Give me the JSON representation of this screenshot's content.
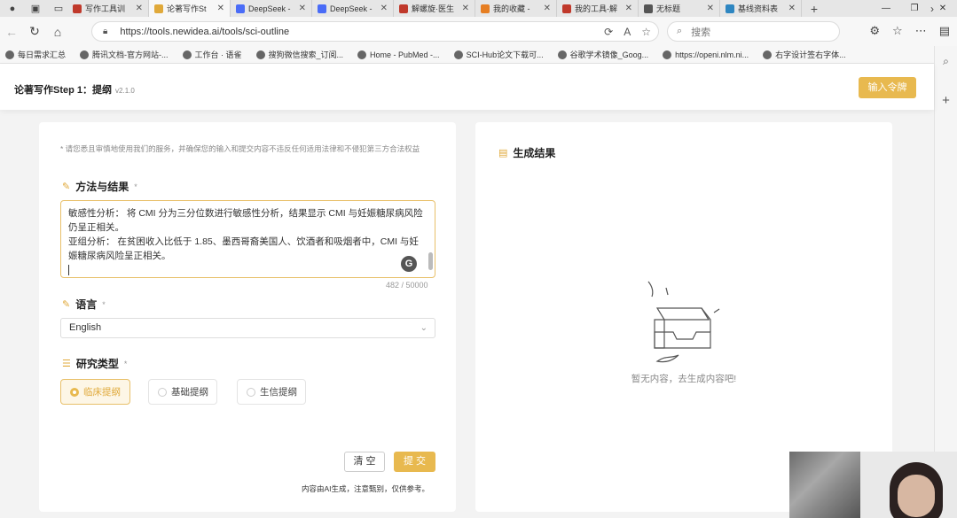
{
  "browser": {
    "tabs": [
      {
        "title": "写作工具训",
        "color": "#c0392b",
        "active": false
      },
      {
        "title": "论著写作St",
        "color": "#e0a93a",
        "active": true
      },
      {
        "title": "DeepSeek -",
        "color": "#4a6cf7",
        "active": false
      },
      {
        "title": "DeepSeek -",
        "color": "#4a6cf7",
        "active": false
      },
      {
        "title": "解螺旋·医生",
        "color": "#c0392b",
        "active": false
      },
      {
        "title": "我的收藏 - ",
        "color": "#e67e22",
        "active": false
      },
      {
        "title": "我的工具-解",
        "color": "#c0392b",
        "active": false
      },
      {
        "title": "无标题",
        "color": "#555555",
        "active": false
      },
      {
        "title": "基线资料表",
        "color": "#2e86c1",
        "active": false
      }
    ],
    "url": "https://tools.newidea.ai/tools/sci-outline",
    "search_placeholder": "搜索",
    "bookmarks": [
      "每日需求汇总",
      "腾讯文档-官方网站-...",
      "工作台 · 语雀",
      "搜狗微信搜索_订阅...",
      "Home - PubMed -...",
      "SCI-Hub论文下载可...",
      "谷歌学术镜像_Goog...",
      "https://openi.nlm.ni...",
      "右字设计签右字体..."
    ]
  },
  "header": {
    "title": "论著写作Step 1：提纲",
    "version": "v2.1.0",
    "command_button": "输入令牌"
  },
  "form": {
    "notice": "* 请您悉且审慎地使用我们的服务，并确保您的输入和提交内容不违反任何适用法律和不侵犯第三方合法权益",
    "methods_label": "方法与结果",
    "required_mark": "*",
    "textarea_lines": [
      "敏感性分析： 将 CMI 分为三分位数进行敏感性分析，结果显示 CMI 与妊娠糖尿病风险",
      "仍呈正相关。",
      "亚组分析： 在贫困收入比低于 1.85、墨西哥裔美国人、饮酒者和吸烟者中，CMI 与妊",
      "娠糖尿病风险呈正相关。"
    ],
    "counter": "482 / 50000",
    "language_label": "语言",
    "language_value": "English",
    "study_type_label": "研究类型",
    "study_types": [
      "临床提纲",
      "基础提纲",
      "生信提纲"
    ],
    "selected_study_type": "临床提纲",
    "clear_button": "清 空",
    "submit_button": "提 交",
    "disclaimer": "内容由AI生成，注意甄别，仅供参考。"
  },
  "result": {
    "title": "生成结果",
    "empty_text": "暂无内容，去生成内容吧!"
  },
  "colors": {
    "accent": "#e8b94f",
    "accent_text": "#e0a93a"
  }
}
